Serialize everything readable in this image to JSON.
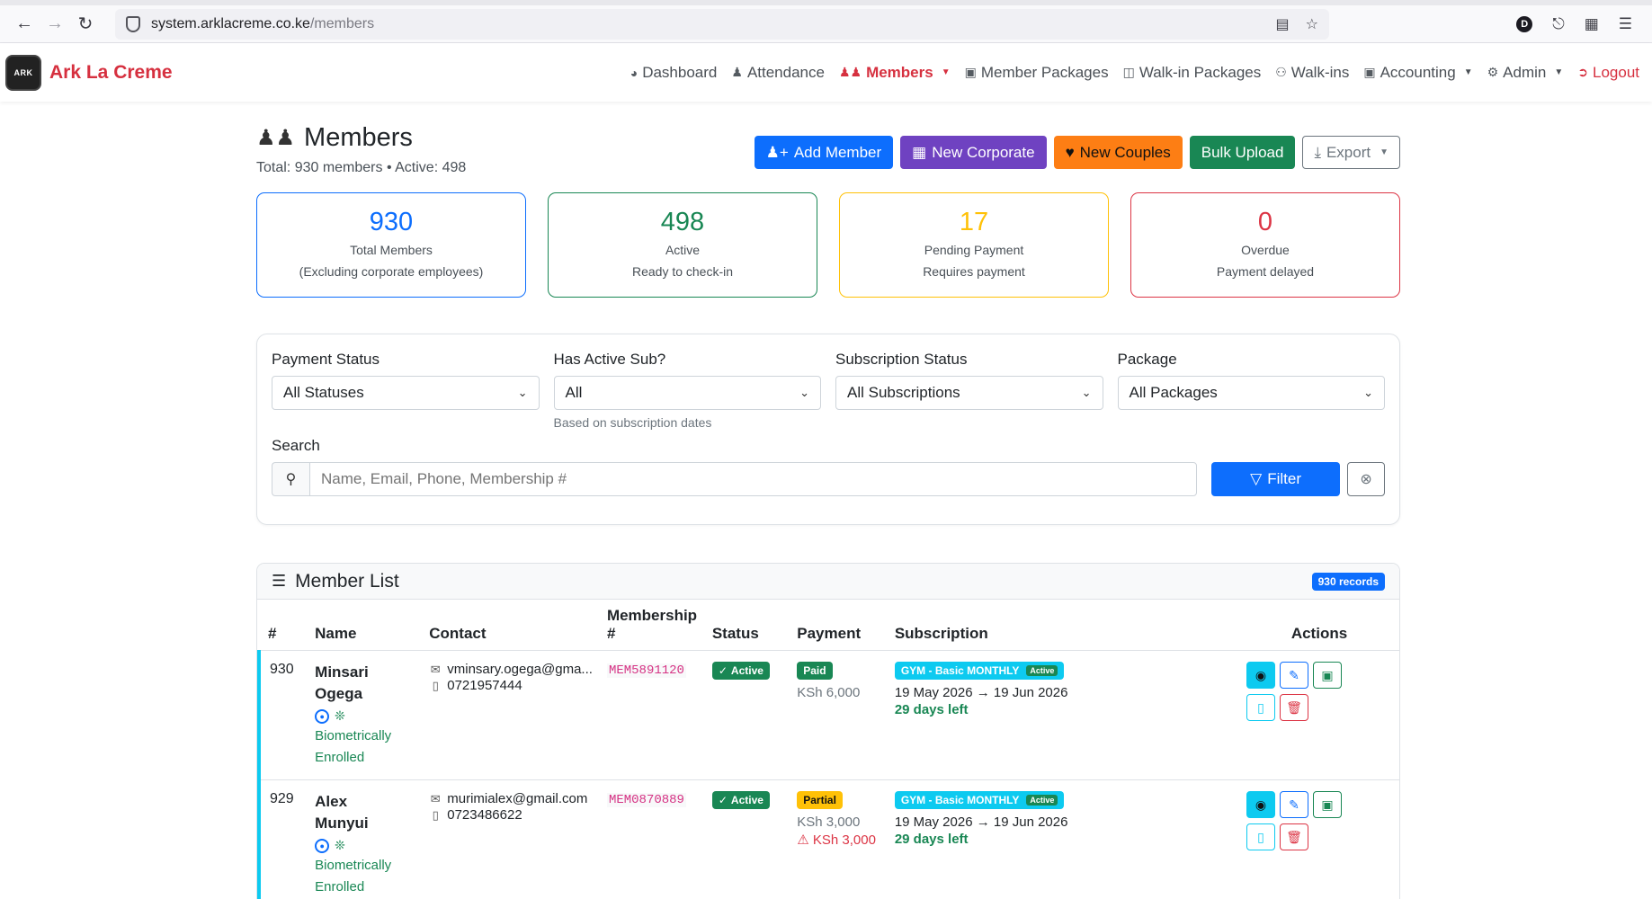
{
  "browser": {
    "url_host": "system.arklacreme.co.ke",
    "url_path": "/members"
  },
  "brand": {
    "logo_text": "ARK",
    "name": "Ark La Creme"
  },
  "nav": {
    "dashboard": "Dashboard",
    "attendance": "Attendance",
    "members": "Members",
    "member_packages": "Member Packages",
    "walkin_packages": "Walk-in Packages",
    "walkins": "Walk-ins",
    "accounting": "Accounting",
    "admin": "Admin",
    "logout": "Logout"
  },
  "page": {
    "title": "Members",
    "subtitle": "Total: 930 members • Active: 498"
  },
  "actions": {
    "add_member": "Add Member",
    "new_corporate": "New Corporate",
    "new_couples": "New Couples",
    "bulk_upload": "Bulk Upload",
    "export": "Export"
  },
  "stats": [
    {
      "value": "930",
      "label": "Total Members",
      "sub": "(Excluding corporate employees)"
    },
    {
      "value": "498",
      "label": "Active",
      "sub": "Ready to check-in"
    },
    {
      "value": "17",
      "label": "Pending Payment",
      "sub": "Requires payment"
    },
    {
      "value": "0",
      "label": "Overdue",
      "sub": "Payment delayed"
    }
  ],
  "filters": {
    "payment_status": {
      "label": "Payment Status",
      "value": "All Statuses"
    },
    "has_active_sub": {
      "label": "Has Active Sub?",
      "value": "All",
      "help": "Based on subscription dates"
    },
    "subscription_status": {
      "label": "Subscription Status",
      "value": "All Subscriptions"
    },
    "package": {
      "label": "Package",
      "value": "All Packages"
    },
    "search": {
      "label": "Search",
      "placeholder": "Name, Email, Phone, Membership #"
    },
    "filter_button": "Filter"
  },
  "member_list": {
    "title": "Member List",
    "records_badge": "930 records",
    "columns": {
      "num": "#",
      "name": "Name",
      "contact": "Contact",
      "membership_line1": "Membership",
      "membership_line2": "#",
      "status": "Status",
      "payment": "Payment",
      "subscription": "Subscription",
      "actions": "Actions"
    },
    "rows": [
      {
        "num": "930",
        "first_name": "Minsari",
        "last_name": "Ogega",
        "bio_line1": "Biometrically",
        "bio_line2": "Enrolled",
        "email": "vminsary.ogega@gma...",
        "phone": "0721957444",
        "membership": "MEM5891120",
        "status": "Active",
        "payment_status": "Paid",
        "amount": "KSh 6,000",
        "due": "",
        "package": "GYM - Basic MONTHLY",
        "package_status": "Active",
        "dates": "19 May 2026 → 19 Jun 2026",
        "days_left": "29 days left"
      },
      {
        "num": "929",
        "first_name": "Alex",
        "last_name": "Munyui",
        "bio_line1": "Biometrically",
        "bio_line2": "Enrolled",
        "email": "murimialex@gmail.com",
        "phone": "0723486622",
        "membership": "MEM0870889",
        "status": "Active",
        "payment_status": "Partial",
        "amount": "KSh 3,000",
        "due": "KSh 3,000",
        "package": "GYM - Basic MONTHLY",
        "package_status": "Active",
        "dates": "19 May 2026 → 19 Jun 2026",
        "days_left": "29 days left"
      }
    ]
  }
}
